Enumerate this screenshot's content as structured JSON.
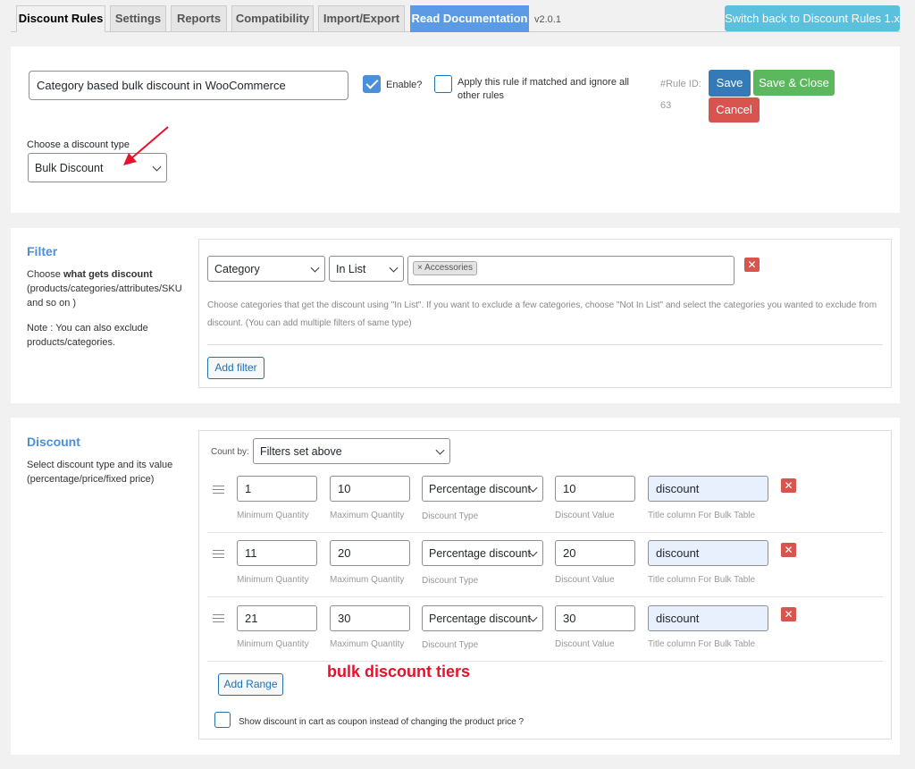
{
  "tabs": [
    {
      "label": "Discount Rules"
    },
    {
      "label": "Settings"
    },
    {
      "label": "Reports"
    },
    {
      "label": "Compatibility"
    },
    {
      "label": "Import/Export"
    },
    {
      "label": "Read Documentation"
    }
  ],
  "version": "v2.0.1",
  "switch_button": "Switch back to Discount Rules 1.x",
  "rule": {
    "title_value": "Category based bulk discount in WooCommerce",
    "enable_label": "Enable?",
    "enable_checked": true,
    "exclusive_label": "Apply this rule if matched and ignore all other rules",
    "exclusive_checked": false,
    "rule_id_label": "#Rule ID:",
    "rule_id_value": "63",
    "save_label": "Save",
    "save_close_label": "Save & Close",
    "cancel_label": "Cancel",
    "discount_type_label": "Choose a discount type",
    "discount_type_value": "Bulk Discount"
  },
  "filter": {
    "title": "Filter",
    "desc_prefix": "Choose ",
    "desc_bold": "what gets discount",
    "desc_rest": "(products/categories/attributes/SKU and so on )",
    "note": "Note : You can also exclude products/categories.",
    "type_value": "Category",
    "operator_value": "In List",
    "tag": "× Accessories",
    "hint": "Choose categories that get the discount using \"In List\". If you want to exclude a few categories, choose \"Not In List\" and select the categories you wanted to exclude from discount. (You can add multiple filters of same type)",
    "add_filter_label": "Add filter"
  },
  "discount": {
    "title": "Discount",
    "desc": "Select discount type and its value (percentage/price/fixed price)",
    "count_by_label": "Count by:",
    "count_by_value": "Filters set above",
    "labels": {
      "min": "Minimum Quantity",
      "max": "Maximum Quantity",
      "type": "Discount Type",
      "value": "Discount Value",
      "title": "Title column For Bulk Table"
    },
    "ranges": [
      {
        "min": "1",
        "max": "10",
        "type": "Percentage discount",
        "value": "10",
        "title": "discount"
      },
      {
        "min": "11",
        "max": "20",
        "type": "Percentage discount",
        "value": "20",
        "title": "discount"
      },
      {
        "min": "21",
        "max": "30",
        "type": "Percentage discount",
        "value": "30",
        "title": "discount"
      }
    ],
    "add_range_label": "Add Range",
    "coupon_label": "Show discount in cart as coupon instead of changing the product price ?",
    "coupon_checked": false
  },
  "annotation": "bulk discount tiers",
  "colors": {
    "accent": "#4a8fdc",
    "save": "#337ab7",
    "save_close": "#5cb85c",
    "cancel": "#d9534f",
    "annotation": "#e8102a"
  }
}
